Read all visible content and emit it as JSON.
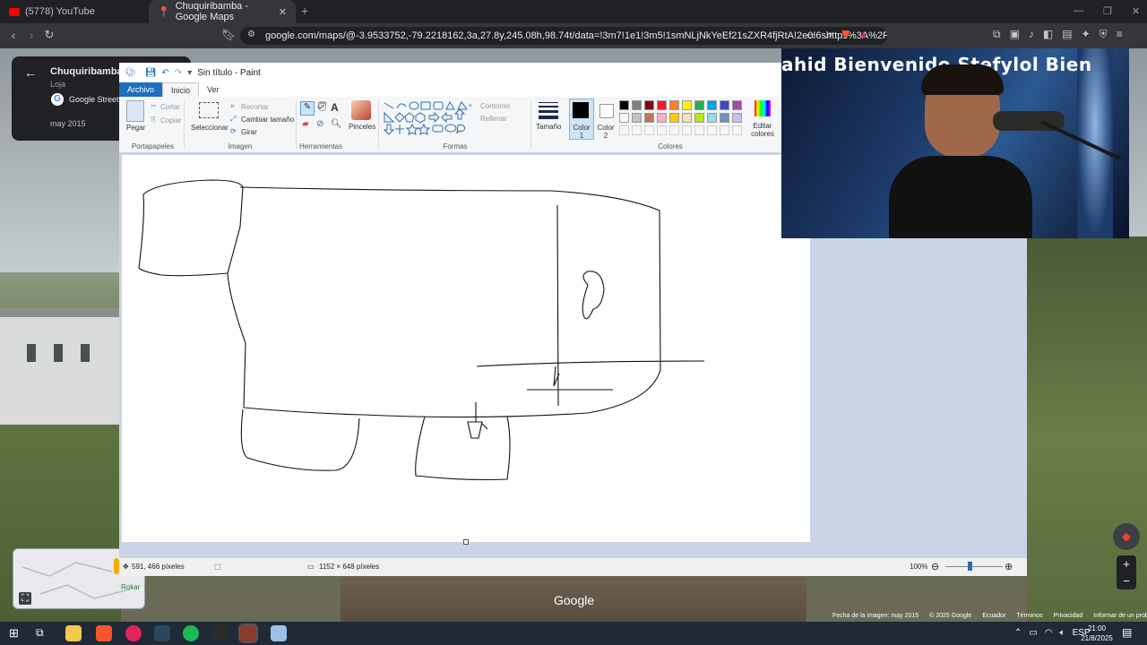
{
  "browser": {
    "tabs": [
      {
        "label": "(5778) YouTube",
        "active": false
      },
      {
        "label": "Chuquiribamba - Google Maps",
        "active": true
      }
    ],
    "new_tab_symbol": "+",
    "url": "google.com/maps/@-3.9533752,-79.2218162,3a,27.8y,245.08h,98.74t/data=!3m7!1e1!3m5!1smNLjNkYeEf21sZXR4fjRtA!2e0!6shttps%3A%2F%2Fstre..."
  },
  "maps": {
    "place_title": "Chuquiribamba",
    "place_subtitle": "Loja",
    "street_view_label": "Google Street",
    "date_label": "may 2015",
    "mini_map_label": "Rokar",
    "google_watermark": "Google",
    "footer": {
      "image_date": "Fecha de la imagen: may 2015",
      "copyright": "© 2025 Google",
      "country": "Ecuador",
      "terms": "Términos",
      "privacy": "Privacidad",
      "report": "Informar de un problema"
    },
    "zoom_in": "+",
    "zoom_out": "−"
  },
  "paint": {
    "title": "Sin título - Paint",
    "ribbon_tabs": [
      "Archivo",
      "Inicio",
      "Ver"
    ],
    "clipboard": {
      "paste": "Pegar",
      "cut": "Cortar",
      "copy": "Copiar",
      "group": "Portapapeles"
    },
    "image": {
      "select": "Seleccionar",
      "crop": "Recortar",
      "resize": "Cambiar tamaño",
      "rotate": "Girar",
      "group": "Imagen"
    },
    "tools": {
      "group": "Herramientas",
      "brushes": "Pinceles"
    },
    "shapes": {
      "outline": "Contorno",
      "fill": "Rellenar",
      "group": "Formas"
    },
    "size": "Tamaño",
    "color1": "Color 1",
    "color2": "Color 2",
    "colors_group": "Colores",
    "edit_colors": "Editar colores",
    "palette_row1": [
      "#000000",
      "#7f7f7f",
      "#880015",
      "#ed1c24",
      "#ff7f27",
      "#fff200",
      "#22b14c",
      "#00a2e8",
      "#3f48cc",
      "#a349a4"
    ],
    "palette_row2": [
      "#ffffff",
      "#c3c3c3",
      "#b97a57",
      "#ffaec9",
      "#ffc90e",
      "#efe4b0",
      "#b5e61d",
      "#99d9ea",
      "#7092be",
      "#c8bfe7"
    ],
    "status": {
      "cursor_pos": "591, 466 píxeles",
      "canvas_size": "1152 × 648 píxeles",
      "zoom": "100%"
    }
  },
  "webcam": {
    "banner_text": "ahid   Bienvenido Stefylol   Bien"
  },
  "taskbar": {
    "language": "ESP",
    "time": "21:00",
    "date": "21/8/2025"
  }
}
